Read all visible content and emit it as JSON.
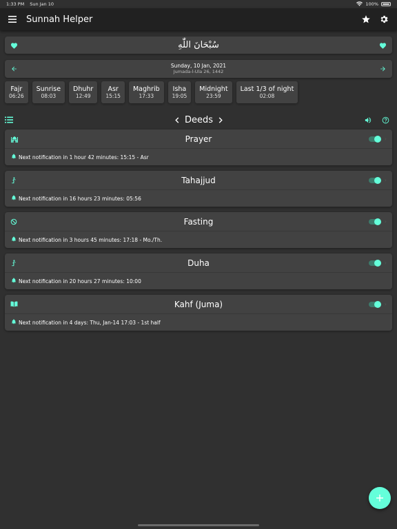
{
  "status": {
    "time": "1:33 PM",
    "date": "Sun Jan 10",
    "battery": "100%"
  },
  "appbar": {
    "title": "Sunnah Helper"
  },
  "dhikr": {
    "text": "سُبْحَانَ اللّٰهِ"
  },
  "date": {
    "gregorian": "Sunday, 10 Jan, 2021",
    "hijri": "Jumada-l-Ula 26, 1442"
  },
  "prayer_times": [
    {
      "name": "Fajr",
      "time": "06:26"
    },
    {
      "name": "Sunrise",
      "time": "08:03"
    },
    {
      "name": "Dhuhr",
      "time": "12:49"
    },
    {
      "name": "Asr",
      "time": "15:15"
    },
    {
      "name": "Maghrib",
      "time": "17:33"
    },
    {
      "name": "Isha",
      "time": "19:05"
    },
    {
      "name": "Midnight",
      "time": "23:59"
    },
    {
      "name": "Last 1/3 of night",
      "time": "02:08"
    }
  ],
  "deeds": {
    "title": "Deeds",
    "items": [
      {
        "title": "Prayer",
        "icon": "mosque-icon",
        "enabled": true,
        "notification": "Next notification in 1 hour 42 minutes: 15:15 - Asr"
      },
      {
        "title": "Tahajjud",
        "icon": "praying-person-icon",
        "enabled": true,
        "notification": "Next notification in 16 hours 23 minutes: 05:56"
      },
      {
        "title": "Fasting",
        "icon": "no-food-icon",
        "enabled": true,
        "notification": "Next notification in 3 hours 45 minutes: 17:18 - Mo./Th."
      },
      {
        "title": "Duha",
        "icon": "praying-person-icon",
        "enabled": true,
        "notification": "Next notification in 20 hours 27 minutes: 10:00"
      },
      {
        "title": "Kahf (Juma)",
        "icon": "book-icon",
        "enabled": true,
        "notification": "Next notification in 4 days: Thu, Jan-14 17:03 - 1st half"
      }
    ]
  },
  "colors": {
    "accent": "#64ffda",
    "background": "#303030",
    "card": "#424242",
    "appbar": "#212121"
  }
}
